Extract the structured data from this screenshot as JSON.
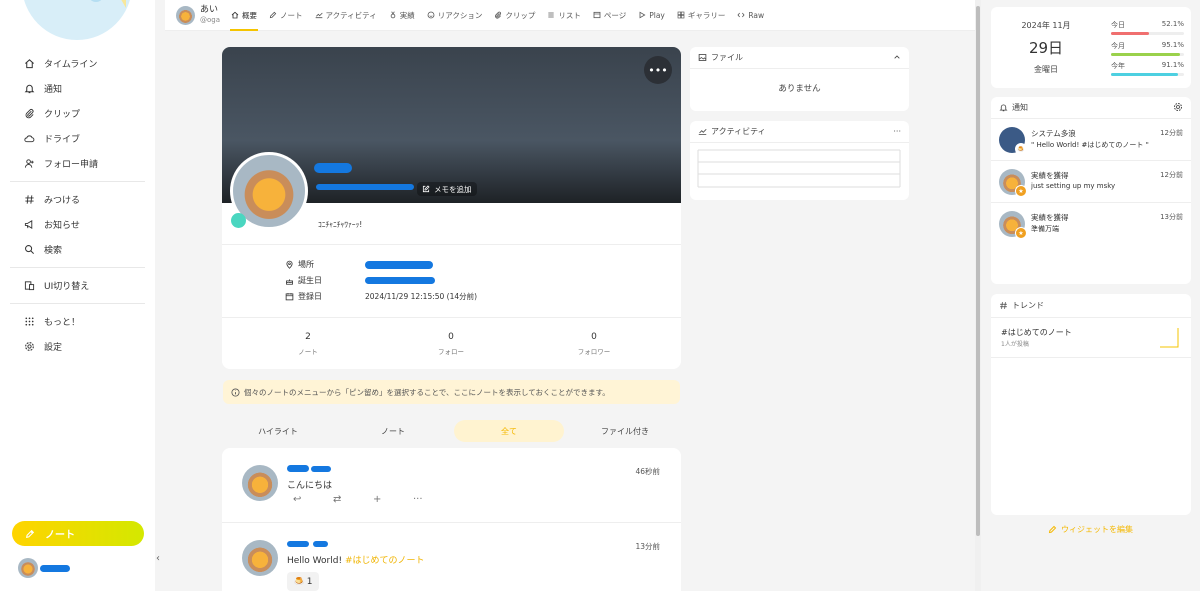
{
  "sidebar": {
    "items": [
      {
        "label": "タイムライン",
        "icon": "home-icon"
      },
      {
        "label": "通知",
        "icon": "bell-icon"
      },
      {
        "label": "クリップ",
        "icon": "paperclip-icon"
      },
      {
        "label": "ドライブ",
        "icon": "cloud-icon"
      },
      {
        "label": "フォロー申請",
        "icon": "user-plus-icon"
      },
      {
        "label": "みつける",
        "icon": "hash-icon"
      },
      {
        "label": "お知らせ",
        "icon": "megaphone-icon"
      },
      {
        "label": "検索",
        "icon": "search-icon"
      },
      {
        "label": "UI切り替え",
        "icon": "devices-icon"
      },
      {
        "label": "もっと！",
        "icon": "grid-icon"
      },
      {
        "label": "設定",
        "icon": "gear-icon"
      }
    ],
    "note_button": "ノート",
    "collapse": "‹"
  },
  "header": {
    "name": "あい",
    "username": "@oga",
    "tabs": [
      "概要",
      "ノート",
      "アクティビティ",
      "実績",
      "リアクション",
      "クリップ",
      "リスト",
      "ページ",
      "Play",
      "ギャラリー",
      "Raw"
    ]
  },
  "profile": {
    "memo_button": "メモを追加",
    "description": "ｺﾆﾁｬﾆﾁｬﾜｧｰｯ!",
    "location_label": "場所",
    "birthday_label": "誕生日",
    "joined_label": "登録日",
    "joined_value": "2024/11/29 12:15:50 (14分前)",
    "stats": [
      {
        "value": "2",
        "label": "ノート"
      },
      {
        "value": "0",
        "label": "フォロー"
      },
      {
        "value": "0",
        "label": "フォロワー"
      }
    ]
  },
  "pin_notice": "個々のノートのメニューから「ピン留め」を選択することで、ここにノートを表示しておくことができます。",
  "filter_tabs": [
    "ハイライト",
    "ノート",
    "全て",
    "ファイル付き"
  ],
  "filter_active": "全て",
  "notes": [
    {
      "time": "46秒前",
      "text": "こんにちは",
      "hashtag": ""
    },
    {
      "time": "13分前",
      "text": "Hello World! ",
      "hashtag": "#はじめてのノート",
      "reaction_count": "1"
    }
  ],
  "widgets_main": {
    "files_title": "ファイル",
    "files_empty": "ありません",
    "activity_title": "アクティビティ"
  },
  "calendar": {
    "year_month": "2024年 11月",
    "day": "29日",
    "weekday": "金曜日",
    "gauges": [
      {
        "label": "今日",
        "value": "52.1%",
        "fraction": 0.521,
        "color": "#f06f6f"
      },
      {
        "label": "今月",
        "value": "95.1%",
        "fraction": 0.951,
        "color": "#9ad14b"
      },
      {
        "label": "今年",
        "value": "91.1%",
        "fraction": 0.911,
        "color": "#4dd0e1"
      }
    ]
  },
  "notifications": {
    "title": "通知",
    "items": [
      {
        "title": "システム多浪",
        "sub": "\" Hello World! #はじめてのノート \"",
        "time": "12分前"
      },
      {
        "title": "実績を獲得",
        "sub": "just setting up my msky",
        "time": "12分前"
      },
      {
        "title": "実績を獲得",
        "sub": "準備万端",
        "time": "13分前"
      }
    ]
  },
  "trend": {
    "title": "トレンド",
    "tag": "#はじめてのノート",
    "sub": "1人が投稿"
  },
  "edit_widgets": "ウィジェットを編集"
}
